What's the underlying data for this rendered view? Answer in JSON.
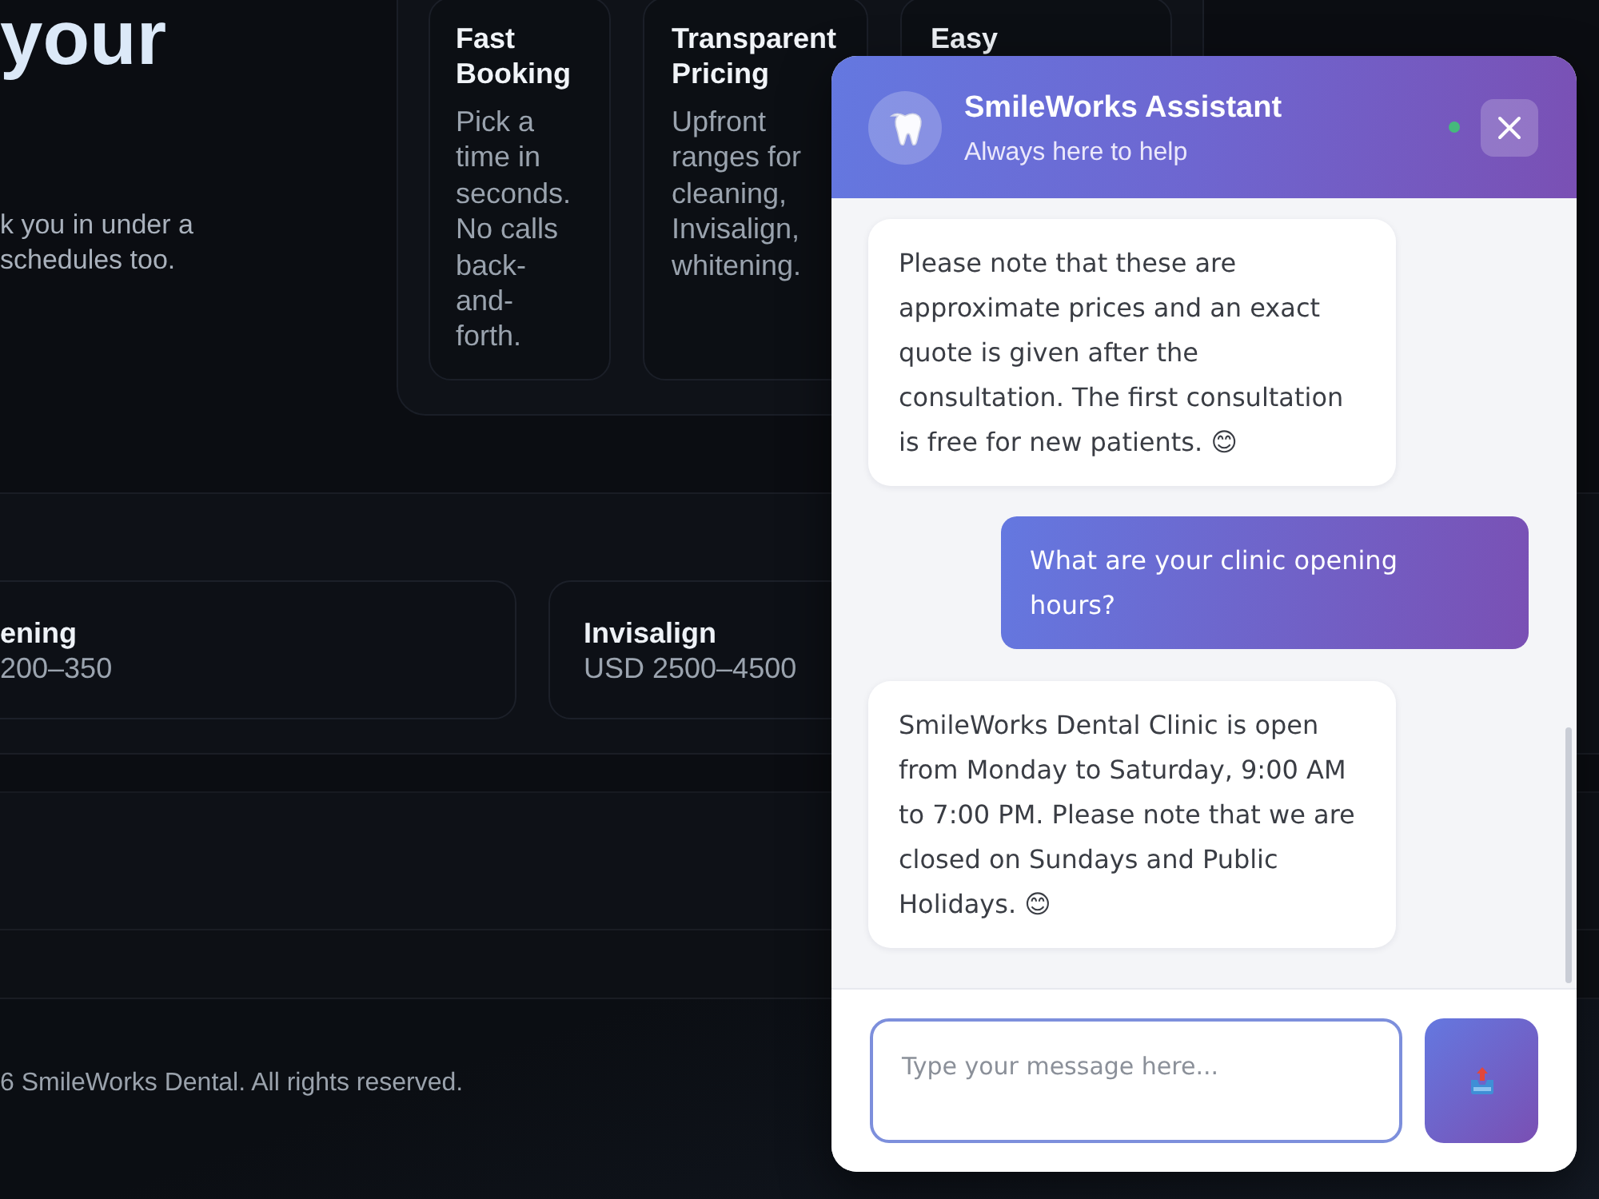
{
  "hero": {
    "heading": "your",
    "text_lines": [
      "k you in under a",
      "schedules too."
    ]
  },
  "features": [
    {
      "title": "Fast Booking",
      "description": "Pick a time in seconds. No calls back-and-forth."
    },
    {
      "title": "Transparent Pricing",
      "description": "Upfront ranges for cleaning, Invisalign, whitening."
    },
    {
      "title": "Easy"
    }
  ],
  "pricing": [
    {
      "name": "ening",
      "price": "200–350"
    },
    {
      "name": "Invisalign",
      "price": "USD 2500–4500"
    }
  ],
  "footer": {
    "copyright": "6 SmileWorks Dental. All rights reserved."
  },
  "chat": {
    "title": "SmileWorks Assistant",
    "subtitle": "Always here to help",
    "online": true,
    "messages": [
      {
        "kind": "bot",
        "text": "Please note that these are approximate prices and an exact quote is given after the consultation. The first consultation is free for new patients. 😊"
      },
      {
        "kind": "user",
        "text": "What are your clinic opening hours?"
      },
      {
        "kind": "bot",
        "text": "SmileWorks Dental Clinic is open from Monday to Saturday, 9:00 AM to 7:00 PM. Please note that we are closed on Sundays and Public Holidays. 😊"
      }
    ],
    "input": {
      "placeholder": "Type your message here..."
    }
  }
}
